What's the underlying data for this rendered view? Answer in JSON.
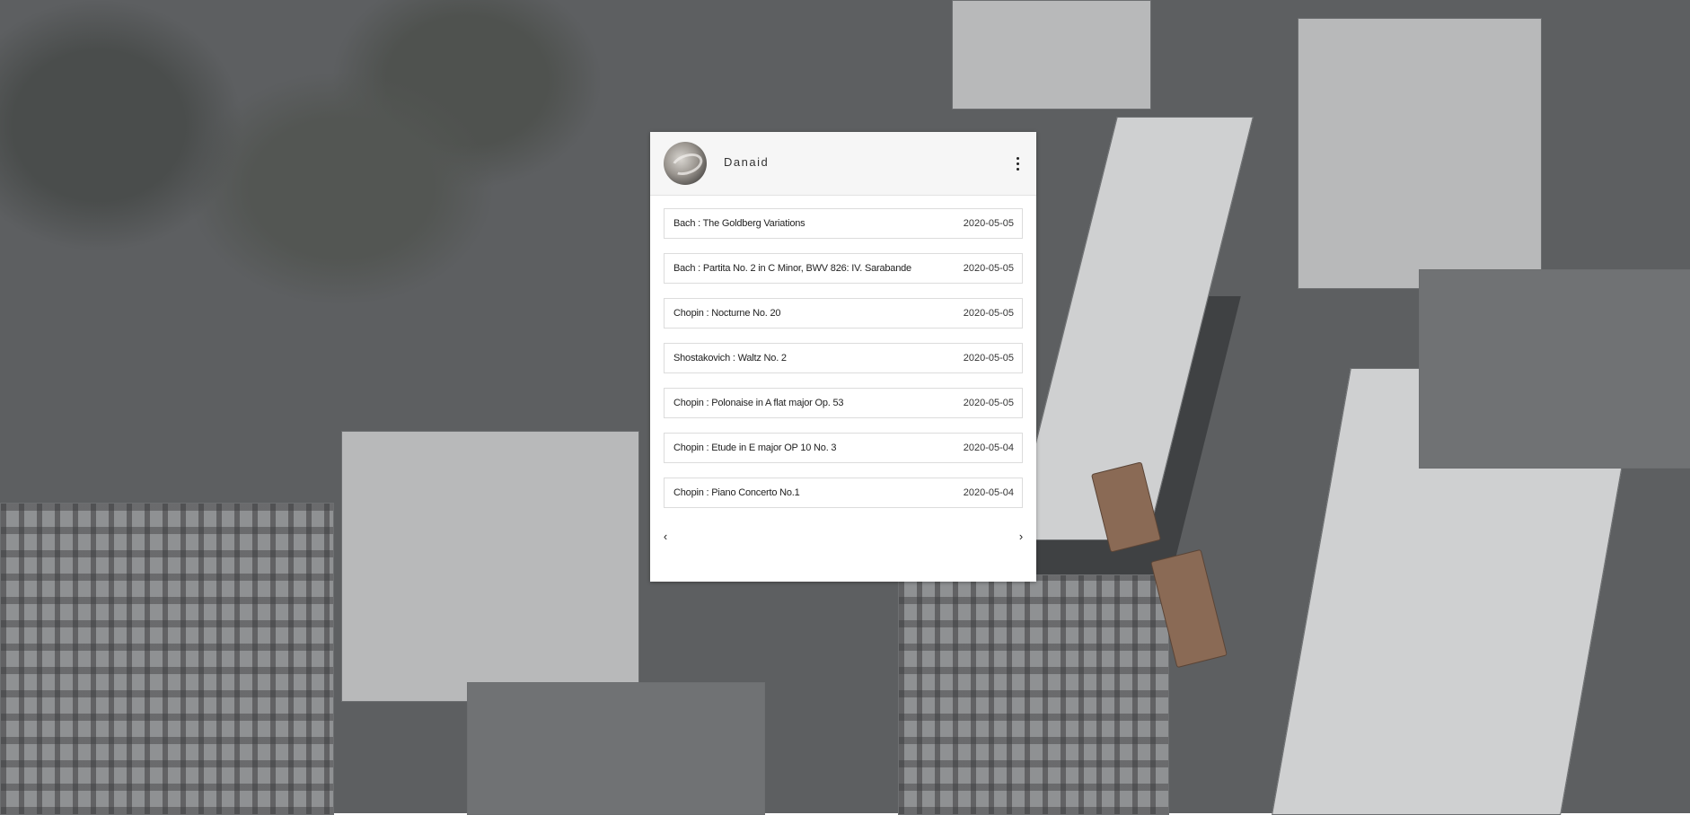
{
  "profile": {
    "username": "Danaid",
    "avatar_icon": "avatar-image",
    "menu_icon": "vertical-ellipsis-icon"
  },
  "tracks": [
    {
      "title": "Bach : The Goldberg Variations",
      "date": "2020-05-05"
    },
    {
      "title": "Bach : Partita No. 2 in C Minor, BWV 826: IV. Sarabande",
      "date": "2020-05-05"
    },
    {
      "title": "Chopin : Nocturne No. 20",
      "date": "2020-05-05"
    },
    {
      "title": "Shostakovich : Waltz No. 2",
      "date": "2020-05-05"
    },
    {
      "title": "Chopin : Polonaise in A flat major Op. 53",
      "date": "2020-05-05"
    },
    {
      "title": "Chopin : Etude in E major OP 10 No. 3",
      "date": "2020-05-04"
    },
    {
      "title": "Chopin : Piano Concerto No.1",
      "date": "2020-05-04"
    }
  ],
  "pager": {
    "prev": "‹",
    "next": "›"
  }
}
